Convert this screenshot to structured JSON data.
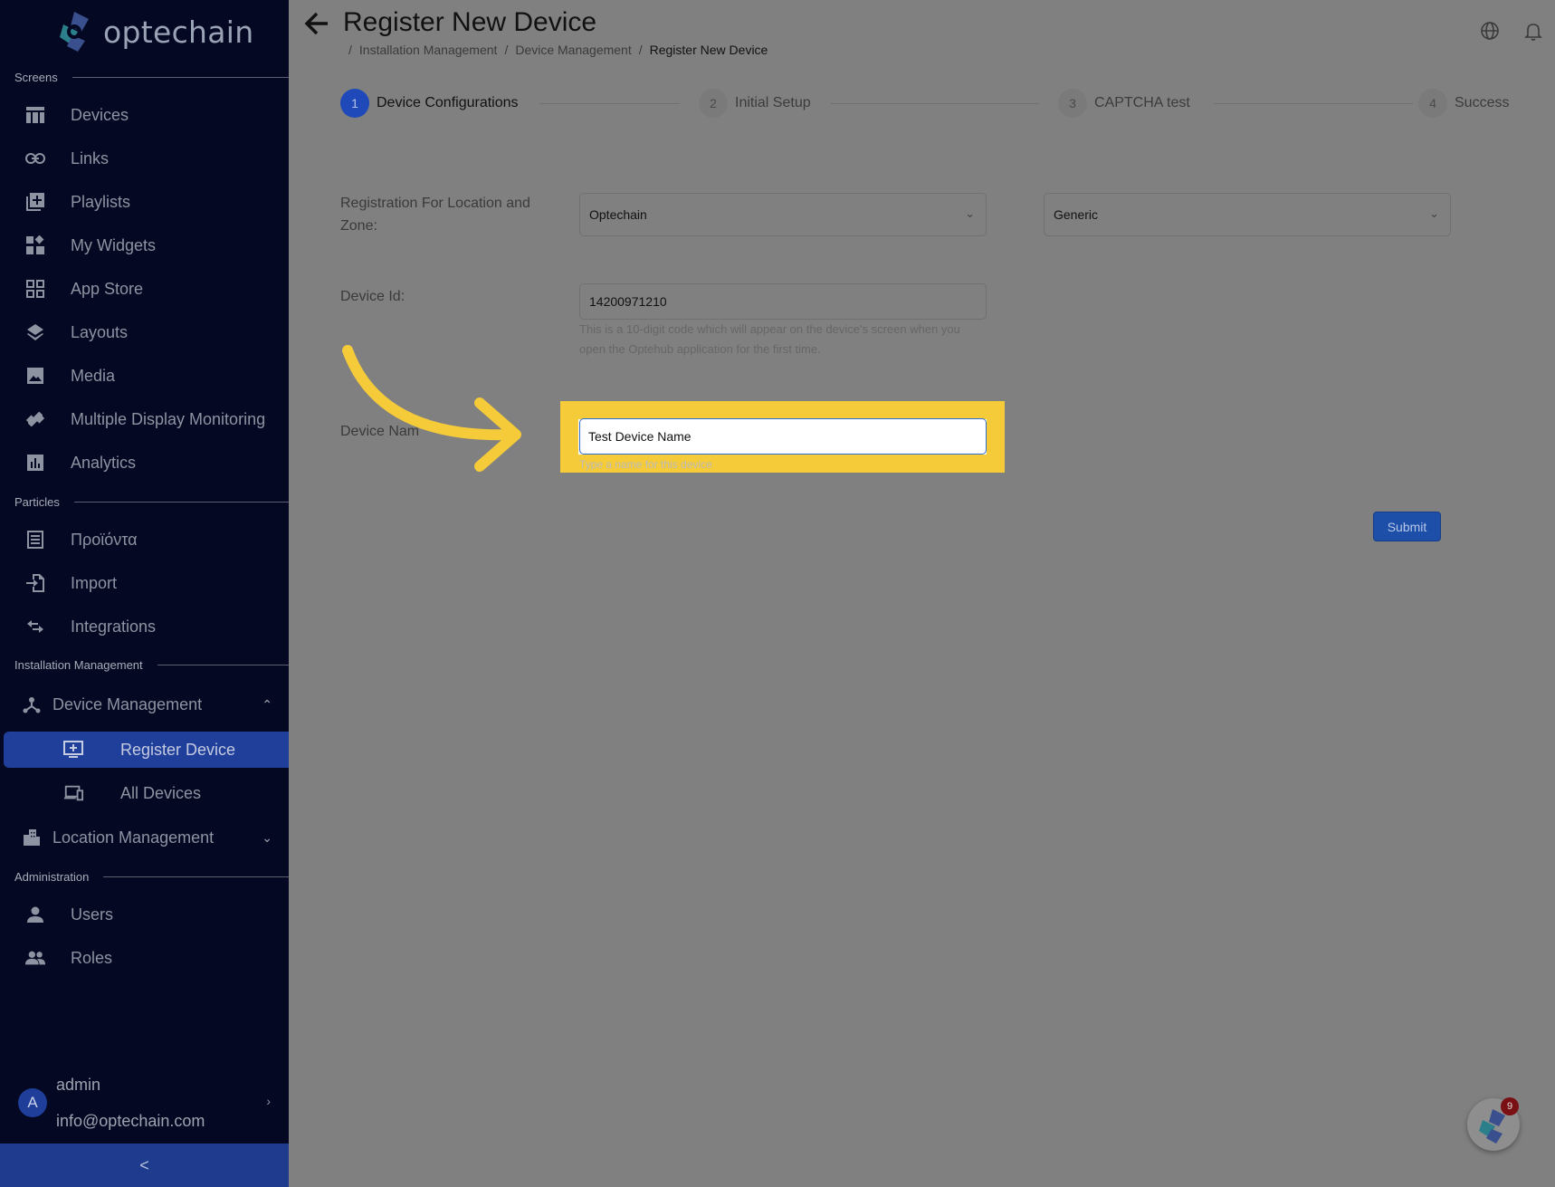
{
  "brand": {
    "name": "optechain"
  },
  "sidebar": {
    "sections": {
      "screens": "Screens",
      "particles": "Particles",
      "installation": "Installation Management",
      "administration": "Administration"
    },
    "screens_items": [
      {
        "label": "Devices",
        "icon": "table-icon"
      },
      {
        "label": "Links",
        "icon": "link-icon"
      },
      {
        "label": "Playlists",
        "icon": "playlist-add-icon"
      },
      {
        "label": "My Widgets",
        "icon": "widgets-icon"
      },
      {
        "label": "App Store",
        "icon": "apps-icon"
      },
      {
        "label": "Layouts",
        "icon": "layers-icon"
      },
      {
        "label": "Media",
        "icon": "image-icon"
      },
      {
        "label": "Multiple Display Monitoring",
        "icon": "satellite-icon"
      },
      {
        "label": "Analytics",
        "icon": "bar-chart-icon"
      }
    ],
    "particles_items": [
      {
        "label": "Προϊόντα",
        "icon": "list-alt-icon"
      },
      {
        "label": "Import",
        "icon": "import-icon"
      },
      {
        "label": "Integrations",
        "icon": "swap-icon"
      }
    ],
    "device_management": {
      "label": "Device Management",
      "children": [
        {
          "label": "Register Device",
          "active": true
        },
        {
          "label": "All Devices",
          "active": false
        }
      ]
    },
    "location_management": {
      "label": "Location Management"
    },
    "admin_items": [
      {
        "label": "Users",
        "icon": "person-icon"
      },
      {
        "label": "Roles",
        "icon": "people-icon"
      }
    ],
    "user": {
      "initial": "A",
      "name": "admin",
      "email": "info@optechain.com"
    },
    "collapse_label": "<"
  },
  "header": {
    "title": "Register New Device",
    "breadcrumb": [
      "Installation Management",
      "Device Management",
      "Register New Device"
    ]
  },
  "steps": [
    {
      "num": "1",
      "label": "Device Configurations",
      "active": true
    },
    {
      "num": "2",
      "label": "Initial Setup",
      "active": false
    },
    {
      "num": "3",
      "label": "CAPTCHA test",
      "active": false
    },
    {
      "num": "4",
      "label": "Success",
      "active": false
    }
  ],
  "form": {
    "registration_label_line1": "Registration For Location and",
    "registration_label_line2": "Zone:",
    "location_value": "Optechain",
    "zone_value": "Generic",
    "device_id_label": "Device Id:",
    "device_id_value": "14200971210",
    "device_id_hint_line1": "This is a 10-digit code which will appear on the device's screen when you",
    "device_id_hint_line2": "open the Optehub application for the first time.",
    "device_name_label": "Device Nam",
    "device_name_value": "Test Device Name",
    "device_name_hint": "Type a name for this device",
    "submit_label": "Submit"
  },
  "fab": {
    "badge": "9"
  },
  "colors": {
    "accent": "#1f48b8",
    "highlight": "#f5cb3a",
    "sidebar_bg": "#050822"
  }
}
